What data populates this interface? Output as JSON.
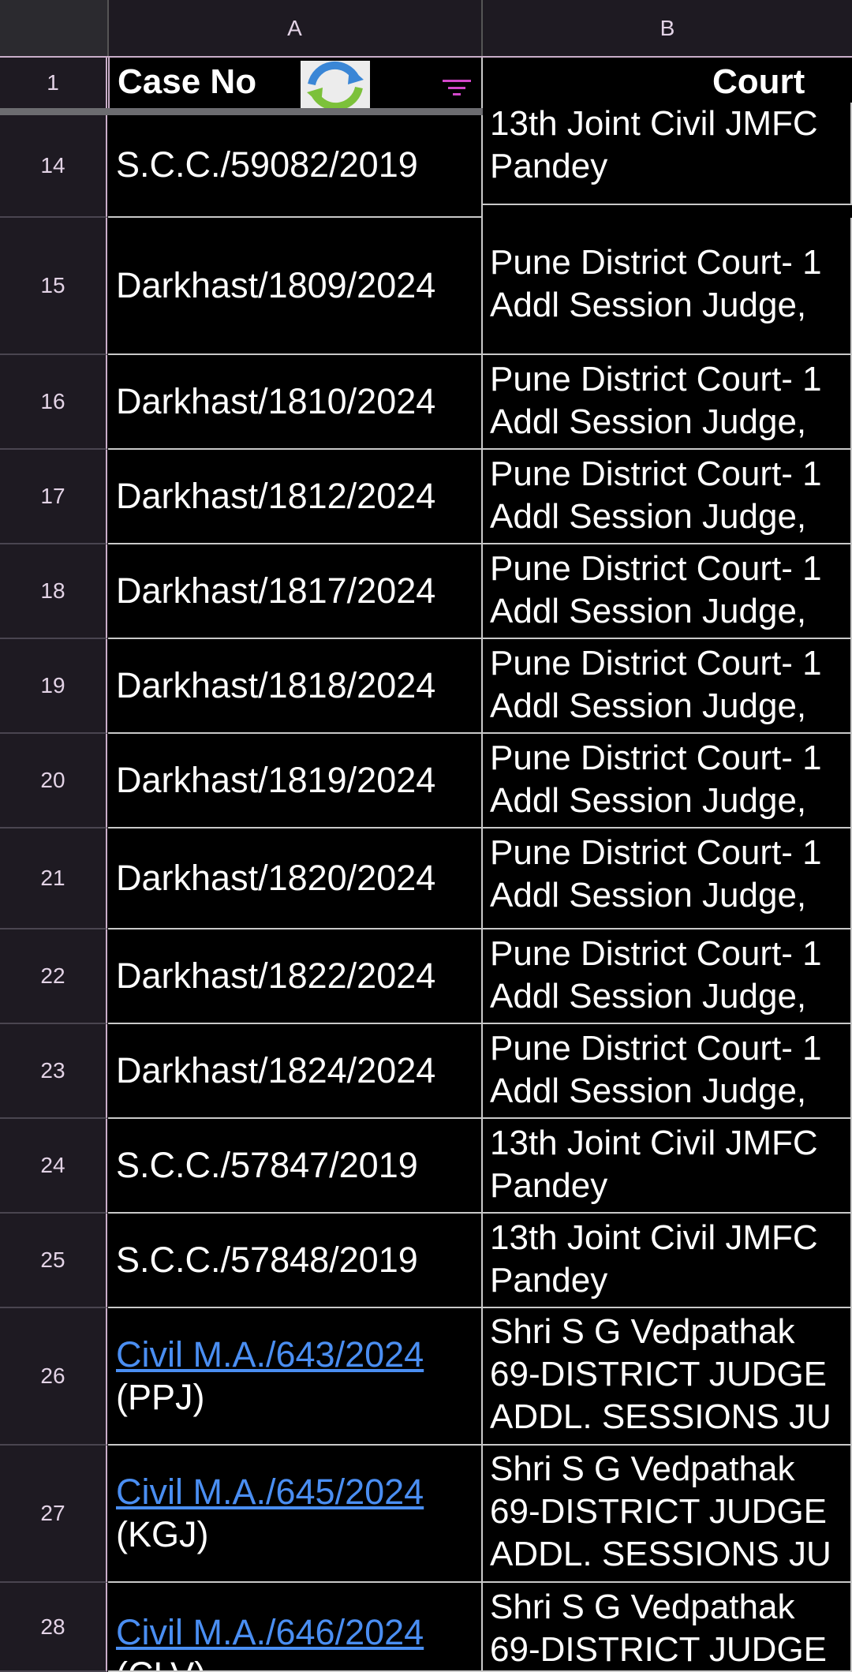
{
  "columns": {
    "a": "A",
    "b": "B"
  },
  "header_row": {
    "number": "1",
    "case_no": "Case No",
    "court": "Court"
  },
  "rows": [
    {
      "num": "14",
      "case": "S.C.C./59082/2019",
      "court": [
        "13th Joint Civil JMFC",
        "Pandey"
      ]
    },
    {
      "num": "15",
      "case": "Darkhast/1809/2024",
      "court": [
        "Pune District Court- 1",
        "Addl Session Judge,"
      ]
    },
    {
      "num": "16",
      "case": "Darkhast/1810/2024",
      "court": [
        "Pune District Court- 1",
        "Addl Session Judge,"
      ]
    },
    {
      "num": "17",
      "case": "Darkhast/1812/2024",
      "court": [
        "Pune District Court- 1",
        "Addl Session Judge,"
      ]
    },
    {
      "num": "18",
      "case": "Darkhast/1817/2024",
      "court": [
        "Pune District Court- 1",
        "Addl Session Judge,"
      ]
    },
    {
      "num": "19",
      "case": "Darkhast/1818/2024",
      "court": [
        "Pune District Court- 1",
        "Addl Session Judge,"
      ]
    },
    {
      "num": "20",
      "case": "Darkhast/1819/2024",
      "court": [
        "Pune District Court- 1",
        "Addl Session Judge,"
      ]
    },
    {
      "num": "21",
      "case": "Darkhast/1820/2024",
      "court": [
        "Pune District Court- 1",
        "Addl Session Judge,"
      ]
    },
    {
      "num": "22",
      "case": "Darkhast/1822/2024",
      "court": [
        "Pune District Court- 1",
        "Addl Session Judge,"
      ]
    },
    {
      "num": "23",
      "case": "Darkhast/1824/2024",
      "court": [
        "Pune District Court- 1",
        "Addl Session Judge,"
      ]
    },
    {
      "num": "24",
      "case": "S.C.C./57847/2019",
      "court": [
        "13th Joint Civil JMFC",
        "Pandey"
      ]
    },
    {
      "num": "25",
      "case": "S.C.C./57848/2019",
      "court": [
        "13th Joint Civil JMFC",
        "Pandey"
      ]
    },
    {
      "num": "26",
      "case": "Civil M.A./643/2024",
      "suffix": "(PPJ)",
      "link": true,
      "court": [
        "Shri S G Vedpathak",
        "69-DISTRICT JUDGE",
        "ADDL. SESSIONS JU"
      ]
    },
    {
      "num": "27",
      "case": "Civil M.A./645/2024",
      "suffix": "(KGJ)",
      "link": true,
      "court": [
        "Shri S G Vedpathak",
        "69-DISTRICT JUDGE",
        "ADDL. SESSIONS JU"
      ]
    },
    {
      "num": "28",
      "case": "Civil M.A./646/2024",
      "suffix": "(CLV)",
      "link": true,
      "court": [
        "Shri S G Vedpathak",
        "69-DISTRICT JUDGE"
      ]
    }
  ],
  "icons": {
    "refresh": "refresh-icon",
    "filter": "filter-icon"
  },
  "colors": {
    "link": "#4a8ef2",
    "header_bg": "#1e1a22",
    "header_text": "#e3d3e6"
  }
}
